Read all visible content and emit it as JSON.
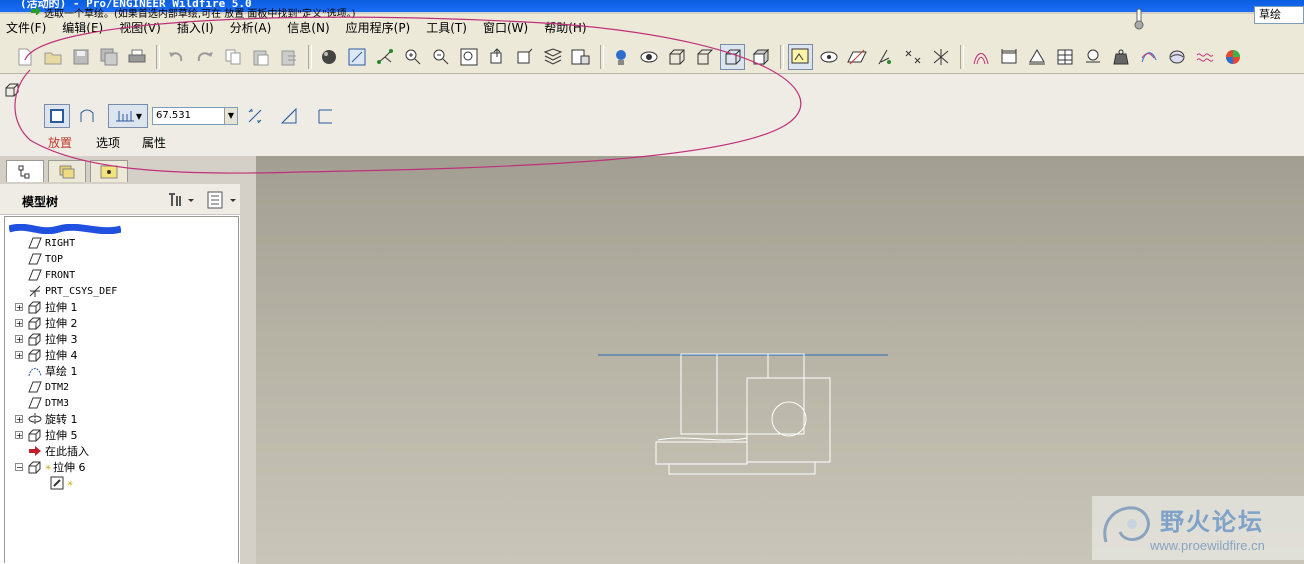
{
  "window": {
    "title": "(活动的) - Pro/ENGINEER Wildfire 5.0"
  },
  "menu": [
    {
      "label": "文件(F)"
    },
    {
      "label": "编辑(E)"
    },
    {
      "label": "视图(V)"
    },
    {
      "label": "插入(I)"
    },
    {
      "label": "分析(A)"
    },
    {
      "label": "信息(N)"
    },
    {
      "label": "应用程序(P)"
    },
    {
      "label": "工具(T)"
    },
    {
      "label": "窗口(W)"
    },
    {
      "label": "帮助(H)"
    }
  ],
  "dashboard": {
    "prompt": "选取一个草绘。(如果首选内部草绘,可在 放置 面板中找到\"定义\"选项。)",
    "depth_value": "67.531",
    "sketch_mode": "草绘",
    "tabs": {
      "placement": "放置",
      "options": "选项",
      "properties": "属性"
    }
  },
  "model_tree": {
    "title": "模型树",
    "items": [
      {
        "label": "RIGHT"
      },
      {
        "label": "TOP"
      },
      {
        "label": "FRONT"
      },
      {
        "label": "PRT_CSYS_DEF"
      },
      {
        "label": "拉伸 1"
      },
      {
        "label": "拉伸 2"
      },
      {
        "label": "拉伸 3"
      },
      {
        "label": "拉伸 4"
      },
      {
        "label": "草绘 1"
      },
      {
        "label": "DTM2"
      },
      {
        "label": "DTM3"
      },
      {
        "label": "旋转 1"
      },
      {
        "label": "拉伸 5"
      },
      {
        "label": "在此插入"
      },
      {
        "label": "拉伸 6"
      }
    ]
  },
  "watermark": {
    "title": "野火论坛",
    "url": "www.proewildfire.cn"
  },
  "colors": {
    "accent_blue": "#0a5ee0",
    "lasso": "#c0307a",
    "viewport_top": "#a29f92",
    "viewport_bottom": "#c9c6b9",
    "highlight_text": "#c0392b"
  },
  "icons": [
    "new-icon",
    "open-icon",
    "save-icon",
    "save-copy-icon",
    "print-icon",
    "undo-icon",
    "redo-icon",
    "copy-icon",
    "paste-icon",
    "paste-special-icon",
    "shading-icon",
    "regenerate-icon",
    "spin-center-icon",
    "zoom-in-icon",
    "zoom-out-icon",
    "refit-icon",
    "reorient-icon",
    "saved-views-icon",
    "layers-icon",
    "view-manager-icon",
    "appearance-icon",
    "eye-icon",
    "wireframe-icon",
    "hidden-line-icon",
    "no-hidden-icon",
    "shaded-icon",
    "shaded-edges-icon",
    "datum-plane-icon",
    "datum-axis-icon",
    "datum-point-icon",
    "csys-icon",
    "annotation-icon"
  ]
}
